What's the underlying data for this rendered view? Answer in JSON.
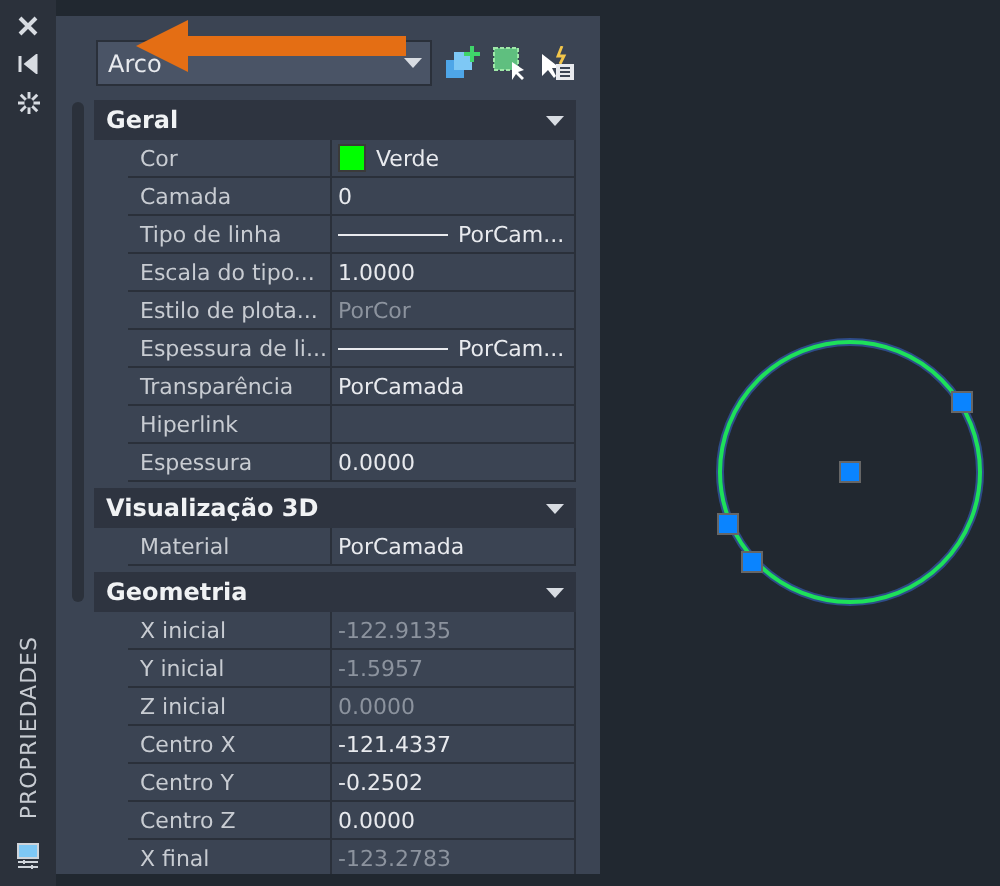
{
  "palette_title": "PROPRIEDADES",
  "selector": {
    "value": "Arco"
  },
  "sections": [
    {
      "title": "Geral",
      "expanded": true,
      "rows": [
        {
          "label": "Cor",
          "value": "Verde",
          "kind": "color",
          "color": "#00ff00",
          "disabled": false
        },
        {
          "label": "Camada",
          "value": "0",
          "kind": "text",
          "disabled": false
        },
        {
          "label": "Tipo de linha",
          "value": "PorCam...",
          "kind": "line",
          "disabled": false
        },
        {
          "label": "Escala do tipo...",
          "value": "1.0000",
          "kind": "text",
          "disabled": false
        },
        {
          "label": "Estilo de plota...",
          "value": "PorCor",
          "kind": "text",
          "disabled": true
        },
        {
          "label": "Espessura de li...",
          "value": "PorCam...",
          "kind": "line",
          "disabled": false
        },
        {
          "label": "Transparência",
          "value": "PorCamada",
          "kind": "text",
          "disabled": false
        },
        {
          "label": "Hiperlink",
          "kind": "text",
          "disabled": false
        },
        {
          "label": "Espessura",
          "value": "0.0000",
          "kind": "text",
          "disabled": false
        }
      ]
    },
    {
      "title": "Visualização 3D",
      "expanded": true,
      "rows": [
        {
          "label": "Material",
          "value": "PorCamada",
          "kind": "text",
          "disabled": false
        }
      ]
    },
    {
      "title": "Geometria",
      "expanded": true,
      "rows": [
        {
          "label": "X inicial",
          "value": "-122.9135",
          "kind": "text",
          "disabled": true
        },
        {
          "label": "Y inicial",
          "value": "-1.5957",
          "kind": "text",
          "disabled": true
        },
        {
          "label": "Z inicial",
          "value": "0.0000",
          "kind": "text",
          "disabled": true
        },
        {
          "label": "Centro X",
          "value": "-121.4337",
          "kind": "text",
          "disabled": false
        },
        {
          "label": "Centro Y",
          "value": "-0.2502",
          "kind": "text",
          "disabled": false
        },
        {
          "label": "Centro Z",
          "value": "0.0000",
          "kind": "text",
          "disabled": false
        },
        {
          "label": "X final",
          "value": "-123.2783",
          "kind": "text",
          "disabled": true
        }
      ]
    }
  ]
}
